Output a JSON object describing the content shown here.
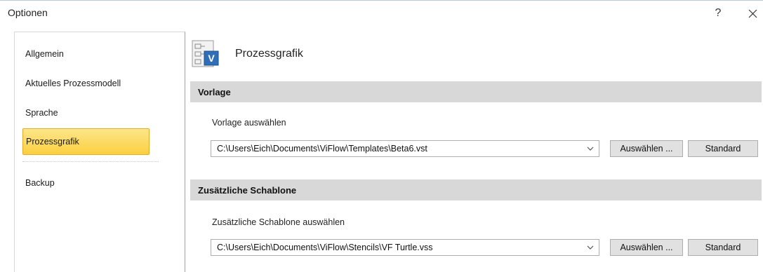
{
  "window": {
    "title": "Optionen",
    "help_label": "?",
    "close_icon": "close-icon"
  },
  "sidebar": {
    "items": [
      {
        "label": "Allgemein",
        "active": false
      },
      {
        "label": "Aktuelles Prozessmodell",
        "active": false
      },
      {
        "label": "Sprache",
        "active": false
      },
      {
        "label": "Prozessgrafik",
        "active": true
      },
      {
        "label": "Backup",
        "active": false
      }
    ]
  },
  "header": {
    "icon": "visio-document-icon",
    "title": "Prozessgrafik"
  },
  "sections": [
    {
      "title": "Vorlage",
      "field_label": "Vorlage auswählen",
      "value": "C:\\Users\\Eich\\Documents\\ViFlow\\Templates\\Beta6.vst",
      "select_label": "Auswählen ...",
      "standard_label": "Standard"
    },
    {
      "title": "Zusätzliche Schablone",
      "field_label": "Zusätzliche Schablone auswählen",
      "value": "C:\\Users\\Eich\\Documents\\ViFlow\\Stencils\\VF Turtle.vss",
      "select_label": "Auswählen ...",
      "standard_label": "Standard"
    }
  ],
  "colors": {
    "active_item": "#fbcf3e",
    "section_bar": "#d8d8d8",
    "icon_blue": "#2f6fb7"
  }
}
